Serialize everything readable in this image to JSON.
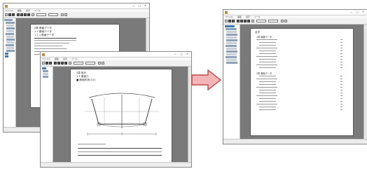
{
  "colors": {
    "arrow_fill": "#f2b6b6",
    "arrow_stroke": "#c94646",
    "selection": "#3c78c8",
    "workspace_bg": "#7a7a7a"
  },
  "icons": {
    "window_controls": "minimize-maximize-close-icons",
    "arrow": "right-arrow-icon"
  },
  "window_a": {
    "menu": [
      "ファイル",
      "編集",
      "表示",
      "ツール"
    ],
    "page": {
      "heading": "2章 断面データ",
      "sub1": "1.1 断面データ",
      "sub2": "1.1.1 断面データ"
    }
  },
  "window_b": {
    "page": {
      "heading": "2章 設計",
      "sub1": "1.1 断面力",
      "bullet": "■ 断面形状(1/1)"
    }
  },
  "window_c": {
    "page": {
      "heading": "目次",
      "entries": [
        "1章 構造データ",
        "2章 断面データ"
      ]
    }
  }
}
